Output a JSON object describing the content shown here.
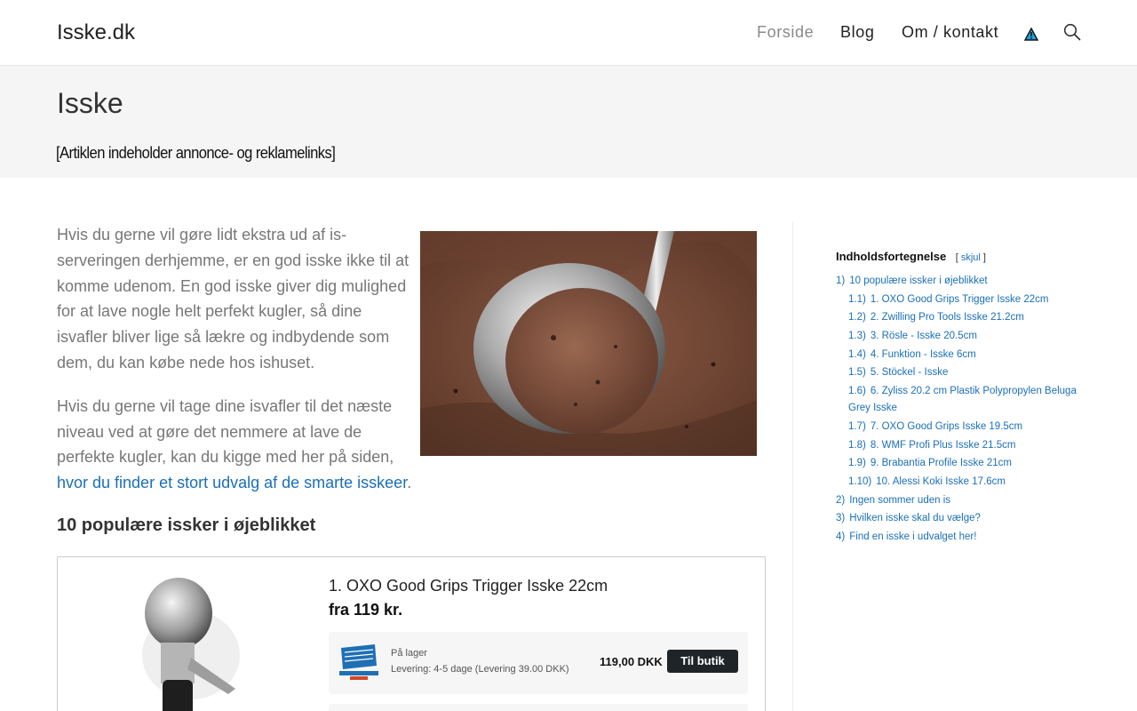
{
  "header": {
    "site_title": "Isske.dk",
    "nav": [
      {
        "label": "Forside"
      },
      {
        "label": "Blog"
      },
      {
        "label": "Om / kontakt"
      }
    ],
    "badge_icon": "warning-triangle-icon",
    "search_icon": "search-icon"
  },
  "title_band": {
    "title": "Isske",
    "disclaimer": "[Artiklen indeholder annonce- og reklamelinks]"
  },
  "intro": {
    "paragraph1": "Hvis du gerne vil gøre lidt ekstra ud af is-serveringen derhjemme, er en god isske ikke til at komme udenom. En god isske giver dig mulighed for at lave nogle helt perfekt kugler, så dine isvafler bliver lige så lækre og indbydende som dem, du kan købe nede hos ishuset.",
    "paragraph2_text": "Hvis du gerne vil tage dine isvafler til det næste niveau ved at gøre det nemmere at lave de perfekte kugler, kan du kigge med her på siden,",
    "paragraph2_link": "hvor du finder et stort udvalg af de smarte isskeer",
    "paragraph2_end": "."
  },
  "section": {
    "heading": "10 populære issker i øjeblikket"
  },
  "product": {
    "name": "1. OXO Good Grips Trigger Isske 22cm",
    "price": "fra 119 kr.",
    "offer": {
      "stock": "På lager",
      "delivery": "Levering: 4-5 dage (Levering 39.00 DKK)",
      "price": "119,00 DKK",
      "button": "Til butik"
    }
  },
  "toc": {
    "title": "Indholdsfortegnelse",
    "toggle_open": "[",
    "toggle_label": "skjul",
    "toggle_close": "]",
    "items": [
      {
        "num": "1)",
        "label": "10 populære issker i øjeblikket",
        "sub": false
      },
      {
        "num": "1.1)",
        "label": "1. OXO Good Grips Trigger Isske 22cm",
        "sub": true
      },
      {
        "num": "1.2)",
        "label": "2. Zwilling Pro Tools Isske 21.2cm",
        "sub": true
      },
      {
        "num": "1.3)",
        "label": "3. Rösle - Isske 20.5cm",
        "sub": true
      },
      {
        "num": "1.4)",
        "label": "4. Funktion - Isske 6cm",
        "sub": true
      },
      {
        "num": "1.5)",
        "label": "5. Stöckel - Isske",
        "sub": true
      },
      {
        "num": "1.6)",
        "label": "6. Zyliss 20.2 cm Plastik Polypropylen Beluga Grey Isske",
        "sub": true
      },
      {
        "num": "1.7)",
        "label": "7. OXO Good Grips Isske 19.5cm",
        "sub": true
      },
      {
        "num": "1.8)",
        "label": "8. WMF Profi Plus Isske 21.5cm",
        "sub": true
      },
      {
        "num": "1.9)",
        "label": "9. Brabantia Profile Isske 21cm",
        "sub": true
      },
      {
        "num": "1.10)",
        "label": "10. Alessi Koki Isske 17.6cm",
        "sub": true
      },
      {
        "num": "2)",
        "label": "Ingen sommer uden is",
        "sub": false
      },
      {
        "num": "3)",
        "label": "Hvilken isske skal du vælge?",
        "sub": false
      },
      {
        "num": "4)",
        "label": "Find en isske i udvalget her!",
        "sub": false
      }
    ]
  }
}
